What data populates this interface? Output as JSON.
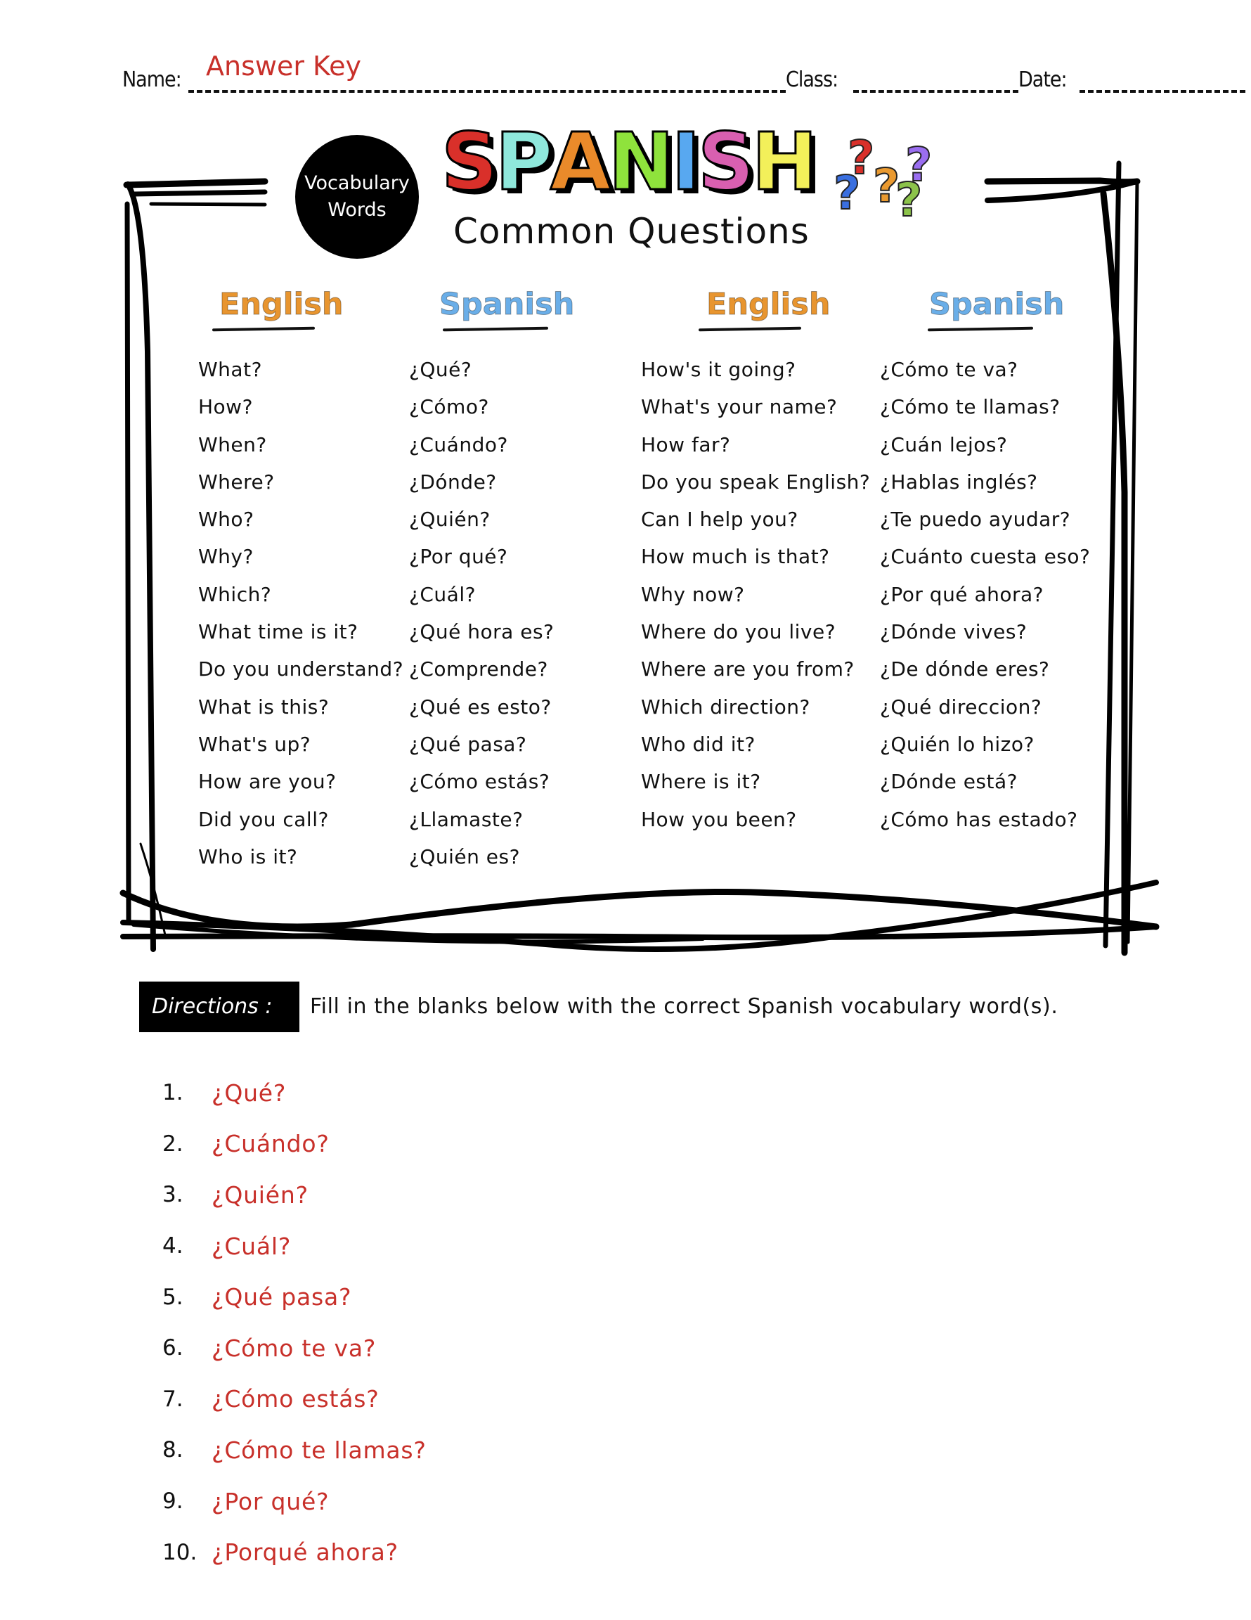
{
  "header": {
    "name_label": "Name:",
    "name_value": "Answer Key",
    "class_label": "Class:",
    "date_label": "Date:"
  },
  "badge": {
    "line1": "Vocabulary",
    "line2": "Words"
  },
  "title": {
    "letters": [
      "S",
      "P",
      "A",
      "N",
      "I",
      "S",
      "H"
    ],
    "letter_colors": [
      "#d9302a",
      "#8fe8dc",
      "#ea8a2a",
      "#8fe33c",
      "#58a8f0",
      "#d95fb0",
      "#f3f05a"
    ],
    "subtitle": "Common Questions",
    "question_mark_colors": [
      "#d9302a",
      "#3a6fe0",
      "#ea9a30",
      "#9a6ef0",
      "#8cc34a"
    ]
  },
  "columns": {
    "english_heading": "English",
    "spanish_heading": "Spanish",
    "left": {
      "english": [
        "What?",
        "How?",
        "When?",
        "Where?",
        "Who?",
        "Why?",
        "Which?",
        "What time is it?",
        "Do you understand?",
        "What is this?",
        "What's up?",
        "How are you?",
        "Did you call?",
        "Who is it?"
      ],
      "spanish": [
        "¿Qué?",
        "¿Cómo?",
        "¿Cuándo?",
        "¿Dónde?",
        "¿Quién?",
        "¿Por qué?",
        "¿Cuál?",
        "¿Qué hora es?",
        "¿Comprende?",
        "¿Qué es esto?",
        "¿Qué pasa?",
        "¿Cómo estás?",
        "¿Llamaste?",
        "¿Quién es?"
      ]
    },
    "right": {
      "english": [
        "How's it going?",
        "What's your name?",
        "How far?",
        "Do you speak English?",
        "Can I help you?",
        "How much is that?",
        "Why now?",
        "Where do you live?",
        "Where are you from?",
        "Which direction?",
        "Who did it?",
        "Where is it?",
        "How you been?"
      ],
      "spanish": [
        "¿Cómo te va?",
        "¿Cómo te llamas?",
        "¿Cuán lejos?",
        "¿Hablas inglés?",
        "¿Te puedo ayudar?",
        "¿Cuánto cuesta eso?",
        "¿Por qué ahora?",
        "¿Dónde vives?",
        "¿De dónde eres?",
        "¿Qué direccion?",
        "¿Quién lo hizo?",
        "¿Dónde está?",
        "¿Cómo has estado?"
      ]
    }
  },
  "directions": {
    "label": "Directions :",
    "text": "Fill in the blanks below with the correct Spanish vocabulary word(s)."
  },
  "answers": [
    {
      "num": "1.",
      "text": "¿Qué?"
    },
    {
      "num": "2.",
      "text": "¿Cuándo?"
    },
    {
      "num": "3.",
      "text": "¿Quién?"
    },
    {
      "num": "4.",
      "text": "¿Cuál?"
    },
    {
      "num": "5.",
      "text": "¿Qué pasa?"
    },
    {
      "num": "6.",
      "text": "¿Cómo te va?"
    },
    {
      "num": "7.",
      "text": "¿Cómo estás?"
    },
    {
      "num": "8.",
      "text": "¿Cómo te llamas?"
    },
    {
      "num": "9.",
      "text": "¿Por qué?"
    },
    {
      "num": "10.",
      "text": "¿Porqué ahora?"
    }
  ],
  "colors": {
    "answer_red": "#c8302a",
    "english_orange": "#e8952f",
    "spanish_blue": "#6aaee8"
  }
}
